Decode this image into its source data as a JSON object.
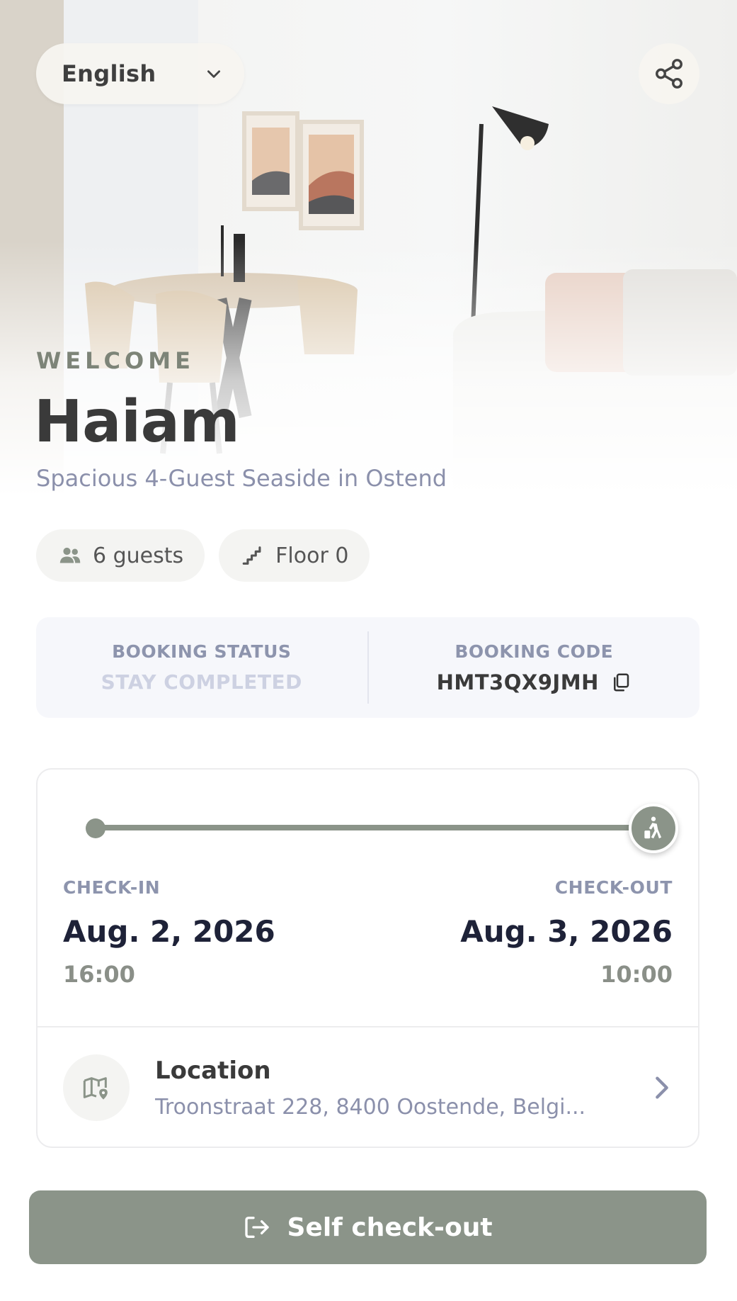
{
  "header": {
    "language": "English",
    "welcome": "WELCOME",
    "guest_name": "Haiam",
    "property_name": "Spacious 4-Guest Seaside in Ostend"
  },
  "chips": {
    "guests": "6 guests",
    "floor": "Floor 0"
  },
  "booking": {
    "status_label": "BOOKING STATUS",
    "status_value": "STAY COMPLETED",
    "code_label": "BOOKING CODE",
    "code_value": "HMT3QX9JMH"
  },
  "stay": {
    "progress": 1.0,
    "checkin_label": "CHECK-IN",
    "checkin_date": "Aug. 2, 2026",
    "checkin_time": "16:00",
    "checkout_label": "CHECK-OUT",
    "checkout_date": "Aug. 3, 2026",
    "checkout_time": "10:00"
  },
  "location": {
    "title": "Location",
    "address": "Troonstraat 228, 8400 Oostende, Belgi..."
  },
  "cta": {
    "label": "Self check-out"
  },
  "icons": {
    "language": "chevron-down-icon",
    "share": "share-icon",
    "guests": "users-icon",
    "floor": "stairs-icon",
    "copy": "copy-icon",
    "checkout_marker": "walking-luggage-icon",
    "location": "map-pin-icon",
    "location_chevron": "chevron-right-icon",
    "cta": "logout-icon"
  },
  "colors": {
    "accent": "#8b9489",
    "muted_text": "#8d94ad",
    "dark_text": "#1e2238",
    "status_faded": "#cdd1e2"
  }
}
